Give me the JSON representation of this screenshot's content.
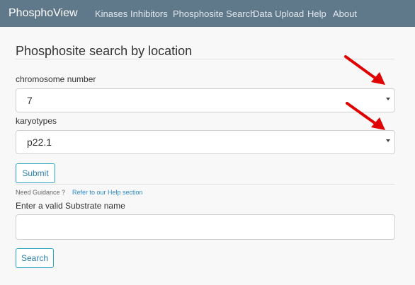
{
  "navbar": {
    "brand": "PhosphoView",
    "links": [
      "Kinases",
      "Inhibitors",
      "Phosphosite Search",
      "Data Upload",
      "Help",
      "About"
    ]
  },
  "main": {
    "title": "Phosphosite search by location",
    "chromosome": {
      "label": "chromosome number",
      "value": "7"
    },
    "karyotypes": {
      "label": "karyotypes",
      "value": "p22.1"
    },
    "submit_label": "Submit",
    "guidance_text": "Need Guidance ?",
    "help_link_text": "Refer to our Help section",
    "substrate": {
      "label": "Enter a valid Substrate name",
      "value": ""
    },
    "search_label": "Search"
  },
  "colors": {
    "navbar_bg": "#5f788a",
    "accent": "#2aa3c0",
    "link": "#2a8bd0",
    "annotation_arrow": "#e00000"
  }
}
